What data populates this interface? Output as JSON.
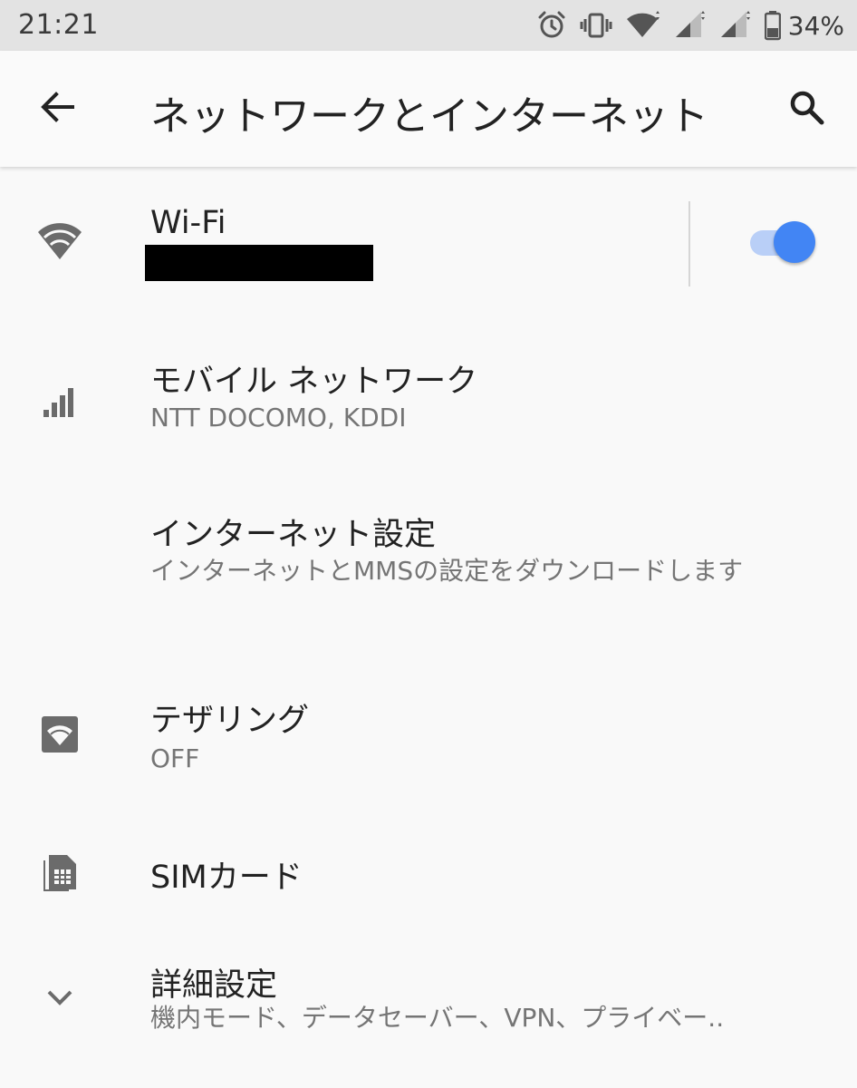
{
  "status_bar": {
    "time": "21:21",
    "battery_percent": "34%",
    "icons": [
      "alarm-icon",
      "vibrate-icon",
      "wifi-icon",
      "signal-icon",
      "signal-icon",
      "battery-icon"
    ]
  },
  "app_bar": {
    "title": "ネットワークとインターネット",
    "back_icon": "arrow-back-icon",
    "search_icon": "search-icon"
  },
  "items": [
    {
      "icon": "wifi-icon",
      "title": "Wi-Fi",
      "subtitle": "",
      "toggle_on": true
    },
    {
      "icon": "signal-icon",
      "title": "モバイル ネットワーク",
      "subtitle": "NTT DOCOMO, KDDI"
    },
    {
      "icon": "",
      "title": "インターネット設定",
      "subtitle": "インターネットとMMSの設定をダウンロードします"
    },
    {
      "icon": "tethering-icon",
      "title": "テザリング",
      "subtitle": "OFF"
    },
    {
      "icon": "sim-card-icon",
      "title": "SIMカード",
      "subtitle": ""
    },
    {
      "icon": "chevron-down-icon",
      "title": "詳細設定",
      "subtitle": "機内モード、データセーバー、VPN、プライベー.."
    }
  ],
  "colors": {
    "accent": "#4285f4",
    "toggle_track": "#b9cff7",
    "icon_gray": "#6b6b6b",
    "background": "#f9f9f9",
    "status_bar": "#e3e3e3"
  }
}
